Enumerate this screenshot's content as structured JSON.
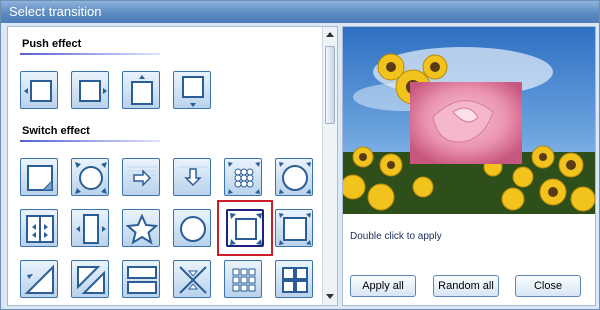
{
  "window": {
    "title": "Select transition"
  },
  "sections": {
    "push": "Push effect",
    "switch": "Switch effect"
  },
  "preview": {
    "hint": "Double click to apply"
  },
  "buttons": {
    "apply_all": "Apply all",
    "random_all": "Random all",
    "close": "Close"
  },
  "colors": {
    "title_bar": "#5c8ac2",
    "tile_border": "#3b73ad",
    "selection": "#cc1d2a",
    "selected_border": "#1a237e"
  },
  "effects": {
    "push": [
      "push-left-icon",
      "push-right-icon",
      "push-up-icon",
      "push-down-icon"
    ],
    "switch_row1": [
      "page-peel-icon",
      "circle-expand-icon",
      "arrow-right-icon",
      "arrow-down-icon",
      "dots-grid-icon",
      "circle-open-icon"
    ],
    "switch_row2": [
      "split-horizontal-icon",
      "split-vertical-icon",
      "star-icon",
      "circle-icon",
      "box-zoom-icon",
      "box-open-icon"
    ],
    "switch_row3": [
      "diagonal-wipe-icon",
      "diagonal-split-icon",
      "slide-blocks-icon",
      "cross-corners-icon",
      "grid-squares-icon",
      "four-squares-icon"
    ],
    "selected": "box-zoom-icon"
  }
}
